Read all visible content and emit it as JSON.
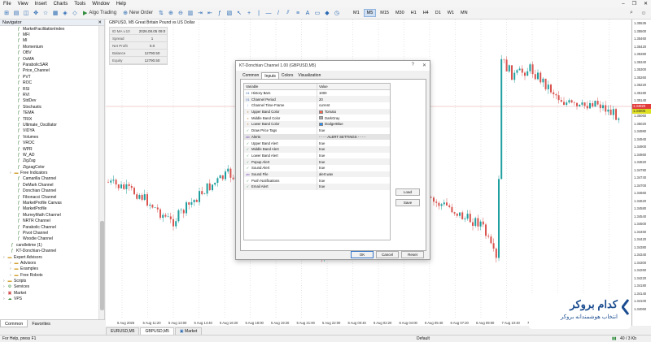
{
  "menu": [
    "File",
    "View",
    "Insert",
    "Charts",
    "Tools",
    "Window",
    "Help"
  ],
  "toolbar": {
    "algo_trading": "Algo Trading",
    "new_order": "New Order",
    "timeframes": [
      "M1",
      "M5",
      "M15",
      "M30",
      "H1",
      "H4",
      "D1",
      "W1",
      "MN"
    ],
    "active_timeframe": "M5"
  },
  "navigator": {
    "title": "Navigator",
    "items": [
      {
        "label": "MarketFacilitationIndex",
        "icon": "indicator-icon",
        "indent": 2
      },
      {
        "label": "MFI",
        "icon": "indicator-icon",
        "indent": 2
      },
      {
        "label": "MI",
        "icon": "indicator-icon",
        "indent": 2
      },
      {
        "label": "Momentum",
        "icon": "indicator-icon",
        "indent": 2
      },
      {
        "label": "OBV",
        "icon": "indicator-icon",
        "indent": 2
      },
      {
        "label": "OsMA",
        "icon": "indicator-icon",
        "indent": 2
      },
      {
        "label": "ParabolicSAR",
        "icon": "indicator-icon",
        "indent": 2
      },
      {
        "label": "Price_Channel",
        "icon": "indicator-icon",
        "indent": 2
      },
      {
        "label": "PVT",
        "icon": "indicator-icon",
        "indent": 2
      },
      {
        "label": "ROC",
        "icon": "indicator-icon",
        "indent": 2
      },
      {
        "label": "RSI",
        "icon": "indicator-icon",
        "indent": 2
      },
      {
        "label": "RVI",
        "icon": "indicator-icon",
        "indent": 2
      },
      {
        "label": "StdDev",
        "icon": "indicator-icon",
        "indent": 2
      },
      {
        "label": "Stochastic",
        "icon": "indicator-icon",
        "indent": 2
      },
      {
        "label": "TEMA",
        "icon": "indicator-icon",
        "indent": 2
      },
      {
        "label": "TRIX",
        "icon": "indicator-icon",
        "indent": 2
      },
      {
        "label": "Ultimate_Oscillator",
        "icon": "indicator-icon",
        "indent": 2
      },
      {
        "label": "VIDYA",
        "icon": "indicator-icon",
        "indent": 2
      },
      {
        "label": "Volumes",
        "icon": "indicator-icon",
        "indent": 2
      },
      {
        "label": "VROC",
        "icon": "indicator-icon",
        "indent": 2
      },
      {
        "label": "WPR",
        "icon": "indicator-icon",
        "indent": 2
      },
      {
        "label": "W_AD",
        "icon": "indicator-icon",
        "indent": 2
      },
      {
        "label": "ZigZag",
        "icon": "indicator-icon",
        "indent": 2
      },
      {
        "label": "ZigzagColor",
        "icon": "indicator-icon",
        "indent": 2
      },
      {
        "label": "Free Indicators",
        "icon": "folder-icon",
        "indent": 1
      },
      {
        "label": "Camarilla Channel",
        "icon": "indicator-icon",
        "indent": 2
      },
      {
        "label": "DeMark Channel",
        "icon": "indicator-icon",
        "indent": 2
      },
      {
        "label": "Donchian Channel",
        "icon": "indicator-icon",
        "indent": 2
      },
      {
        "label": "Fibonacci Channel",
        "icon": "indicator-icon",
        "indent": 2
      },
      {
        "label": "MarketProfile Canvas",
        "icon": "indicator-icon",
        "indent": 2
      },
      {
        "label": "MarketProfile",
        "icon": "indicator-icon",
        "indent": 2
      },
      {
        "label": "MurreyMath Channel",
        "icon": "indicator-icon",
        "indent": 2
      },
      {
        "label": "NRTR Channel",
        "icon": "indicator-icon",
        "indent": 2
      },
      {
        "label": "Parabolic Channel",
        "icon": "indicator-icon",
        "indent": 2
      },
      {
        "label": "Pivot Channel",
        "icon": "indicator-icon",
        "indent": 2
      },
      {
        "label": "Woodie Channel",
        "icon": "indicator-icon",
        "indent": 2
      },
      {
        "label": "candletime (1)",
        "icon": "indicator-icon",
        "indent": 1
      },
      {
        "label": "KT-Donchian-Channel",
        "icon": "indicator-icon",
        "indent": 1
      },
      {
        "label": "Expert Advisors",
        "icon": "folder-icon",
        "indent": 0
      },
      {
        "label": "Advisors",
        "icon": "folder-icon",
        "indent": 1
      },
      {
        "label": "Examples",
        "icon": "folder-icon",
        "indent": 1
      },
      {
        "label": "Free Robots",
        "icon": "folder-icon",
        "indent": 1
      },
      {
        "label": "Scripts",
        "icon": "folder-icon",
        "indent": 0
      },
      {
        "label": "Services",
        "icon": "service-icon",
        "indent": 0
      },
      {
        "label": "Market",
        "icon": "market-icon",
        "indent": 0
      },
      {
        "label": "VPS",
        "icon": "vps-icon",
        "indent": 0
      }
    ],
    "tabs": [
      "Common",
      "Favorites"
    ]
  },
  "chart": {
    "symbol_label": "GBPUSD, M5  Great Britain Pound vs US Dollar",
    "info_panel": [
      {
        "label": "ID MA v.10",
        "value": "2026.08.05 09:0"
      },
      {
        "label": "Spread",
        "value": "1"
      },
      {
        "label": "Net Profit",
        "value": "0.0"
      },
      {
        "label": "Balance",
        "value": "12790.50"
      },
      {
        "label": "Equity",
        "value": "12790.50"
      }
    ],
    "price_labels": [
      "1.35535",
      "1.35500",
      "1.35460",
      "1.35420",
      "1.35380",
      "1.35340",
      "1.35300",
      "1.35260",
      "1.35220",
      "1.35180",
      "1.35140",
      "1.35100",
      "1.35060",
      "1.35020",
      "1.34980",
      "1.34940",
      "1.34900",
      "1.34860",
      "1.34820",
      "1.34780",
      "1.34740",
      "1.34700",
      "1.34660",
      "1.34620",
      "1.34580",
      "1.34540",
      "1.34500",
      "1.34460",
      "1.34420",
      "1.34380",
      "1.34340",
      "1.34300",
      "1.34260",
      "1.34220",
      "1.34180",
      "1.34140",
      "1.34100",
      "1.34060"
    ],
    "bid_label": "1.34920",
    "ask_label": "1.34905",
    "time_labels": [
      "5 Aug 2025",
      "5 Aug 11:20",
      "5 Aug 13:00",
      "5 Aug 14:40",
      "5 Aug 16:20",
      "5 Aug 18:00",
      "5 Aug 19:20",
      "5 Aug 21:00",
      "5 Aug 22:00",
      "6 Aug 00:40",
      "6 Aug 02:20",
      "6 Aug 04:00",
      "6 Aug 05:40",
      "6 Aug 07:20",
      "6 Aug 09:00",
      "7 Aug 10:40",
      "7 Aug 12:20",
      "7 Aug 14:00",
      "7 Aug 15:40",
      "7 Aug 17:20"
    ],
    "tabs": [
      "EURUSD,M5",
      "GBPUSD,M5",
      "Market"
    ],
    "active_tab": "GBPUSD,M5",
    "bull_color": "#1e9e9e",
    "bear_color": "#d9534f"
  },
  "dialog": {
    "title": "KT-Donchian Channel 1.00 (GBPUSD,M5)",
    "tabs": [
      "Common",
      "Inputs",
      "Colors",
      "Visualization"
    ],
    "active_tab": "Inputs",
    "col_variable": "Variable",
    "col_value": "Value",
    "params": [
      {
        "name": "History Bars",
        "value": "1000",
        "icon": "int-icon"
      },
      {
        "name": "Channel Period",
        "value": "20",
        "icon": "int-icon"
      },
      {
        "name": "Channel Time-Frame",
        "value": "current",
        "icon": "enum-icon"
      },
      {
        "name": "Upper Band Color",
        "value": "Tomato",
        "icon": "color-icon",
        "swatch": "#ff6347"
      },
      {
        "name": "Middle Band Color",
        "value": "DarkGray",
        "icon": "color-icon",
        "swatch": "#a9a9a9"
      },
      {
        "name": "Lower Band Color",
        "value": "DodgerBlue",
        "icon": "color-icon",
        "swatch": "#1e90ff"
      },
      {
        "name": "Draw Price Tags",
        "value": "true",
        "icon": "bool-icon"
      },
      {
        "name": "Alerts",
        "value": "- - - - ALERT SETTINGS - - - -",
        "icon": "string-icon",
        "section": true
      },
      {
        "name": "Upper Band Alert",
        "value": "true",
        "icon": "bool-icon"
      },
      {
        "name": "Middle Band Alert",
        "value": "true",
        "icon": "bool-icon"
      },
      {
        "name": "Lower Band Alert",
        "value": "true",
        "icon": "bool-icon"
      },
      {
        "name": "Popup Alert",
        "value": "true",
        "icon": "bool-icon"
      },
      {
        "name": "Sound Alert",
        "value": "true",
        "icon": "bool-icon"
      },
      {
        "name": "Sound File",
        "value": "alert.wav",
        "icon": "string-icon"
      },
      {
        "name": "Push Notifications",
        "value": "true",
        "icon": "bool-icon"
      },
      {
        "name": "Email Alert",
        "value": "true",
        "icon": "bool-icon"
      }
    ],
    "load_label": "Load",
    "save_label": "Save",
    "ok_label": "OK",
    "cancel_label": "Cancel",
    "reset_label": "Reset"
  },
  "status": {
    "help": "For Help, press F1",
    "profile": "Default",
    "traffic": "40 / 3 Kb"
  },
  "logo": {
    "brand": "کدام بروکر",
    "tagline": "انتخاب هوشمندانه بروکر",
    "color": "#1b4c8f"
  }
}
